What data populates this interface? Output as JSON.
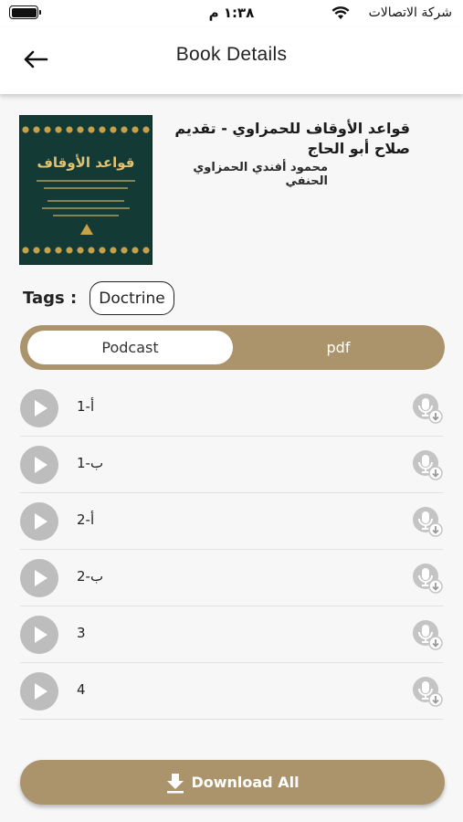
{
  "status_bar": {
    "time": "١:٣٨ م",
    "carrier": "شركة الاتصالات",
    "battery_level": 1.0
  },
  "header": {
    "title": "Book Details",
    "back_icon": "arrow-left-icon"
  },
  "book": {
    "cover_title": "قواعد الأوقاف",
    "title": "قواعد الأوقاف للحمزاوي - تقديم صلاح أبو الحاج",
    "author": "محمود أفندي الحمزاوي الحنفي"
  },
  "tags": {
    "label": "Tags :",
    "items": [
      "Doctrine"
    ]
  },
  "tabs": [
    {
      "label": "Podcast",
      "active": true
    },
    {
      "label": "pdf",
      "active": false
    }
  ],
  "tracks": [
    {
      "label": "1-أ"
    },
    {
      "label": "1-ب"
    },
    {
      "label": "2-أ"
    },
    {
      "label": "2-ب"
    },
    {
      "label": "3"
    },
    {
      "label": "4"
    }
  ],
  "download_all": {
    "label": "Download All",
    "icon": "download-icon"
  },
  "colors": {
    "accent": "#ab946b",
    "play_button": "#bdbdbd",
    "cover_bg": "#143a35",
    "cover_gold": "#c8a24a"
  }
}
